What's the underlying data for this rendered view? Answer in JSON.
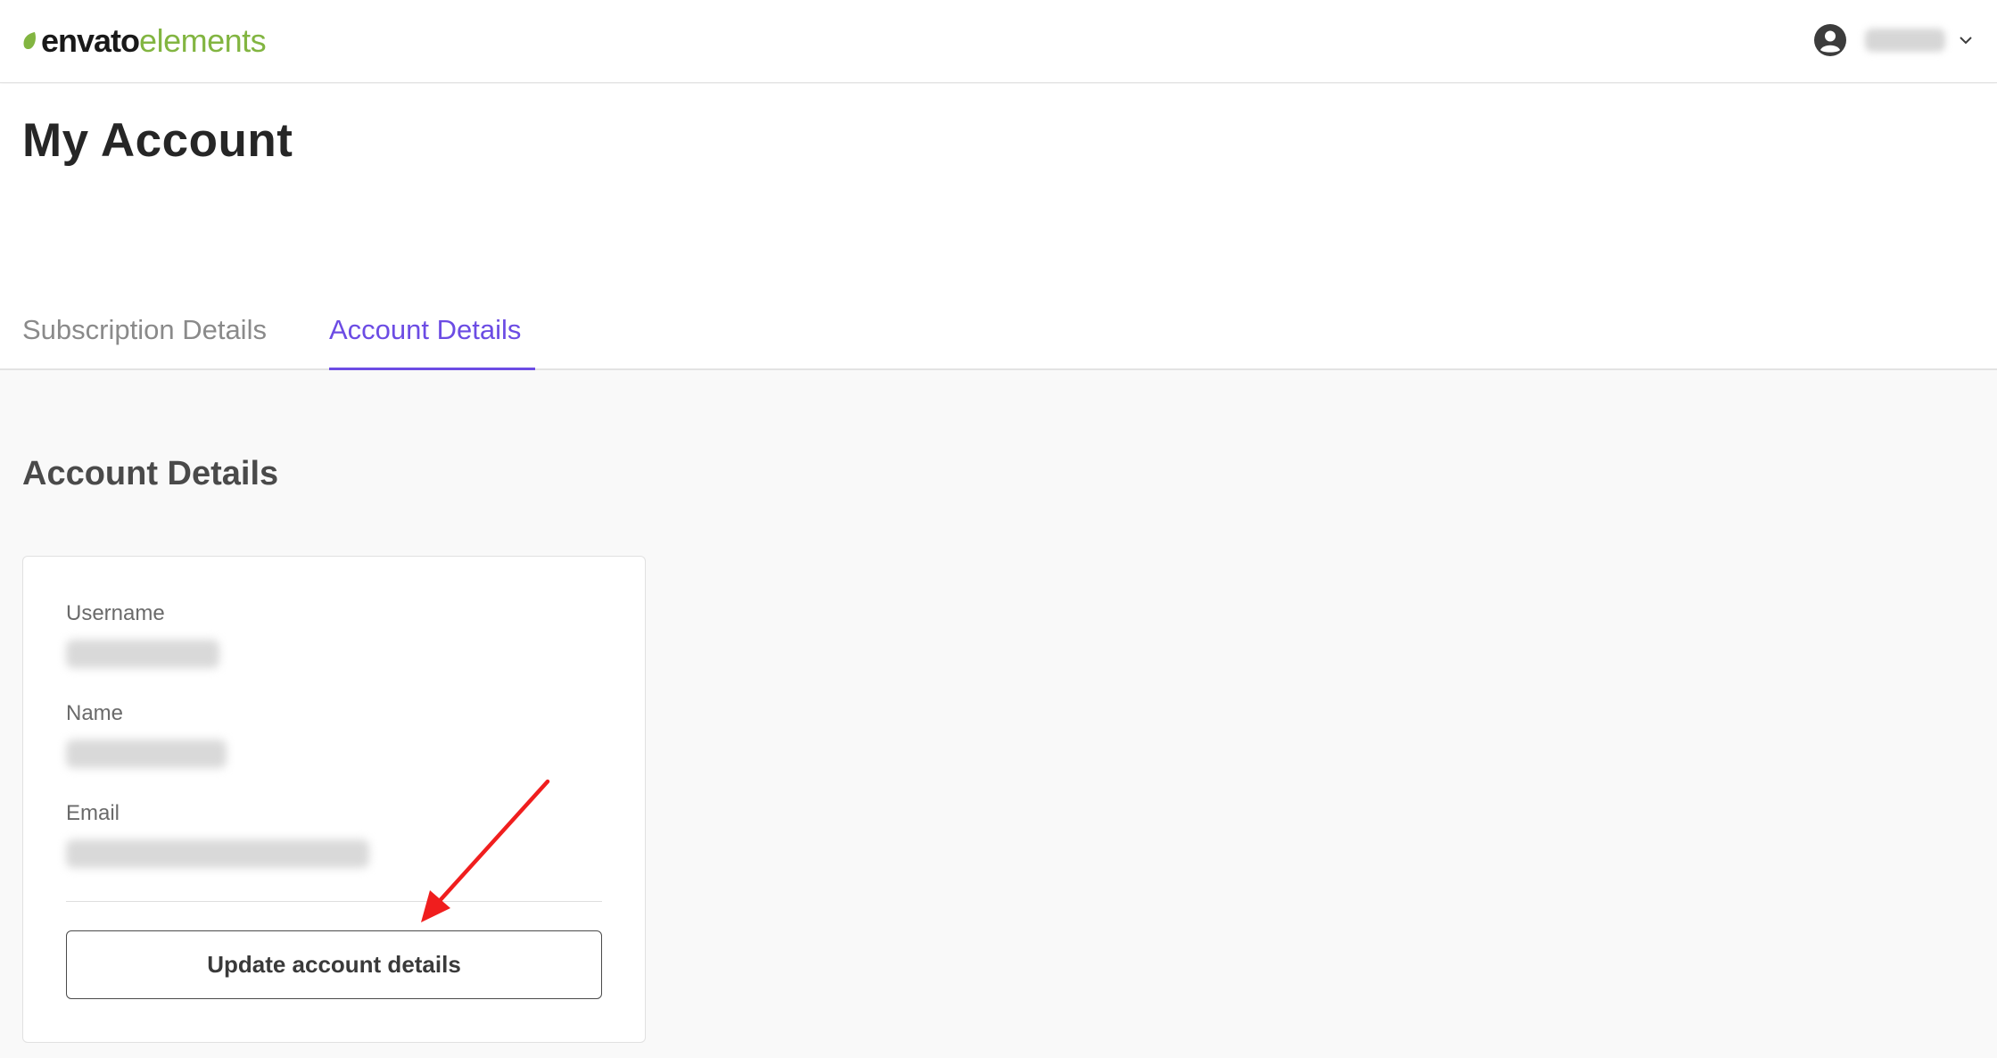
{
  "brand": {
    "name_part1": "envato",
    "name_part2": "elements",
    "accent_color": "#82b541"
  },
  "header": {
    "user_icon": "account-circle-icon",
    "menu_icon": "chevron-down-icon"
  },
  "page": {
    "title": "My Account",
    "tabs": [
      {
        "label": "Subscription Details",
        "active": false
      },
      {
        "label": "Account Details",
        "active": true
      }
    ],
    "active_tab_color": "#6c4ce4"
  },
  "account": {
    "section_title": "Account Details",
    "fields": [
      {
        "label": "Username"
      },
      {
        "label": "Name"
      },
      {
        "label": "Email"
      }
    ],
    "update_button_label": "Update account details"
  },
  "annotation": {
    "arrow_color": "#f01e1e"
  }
}
